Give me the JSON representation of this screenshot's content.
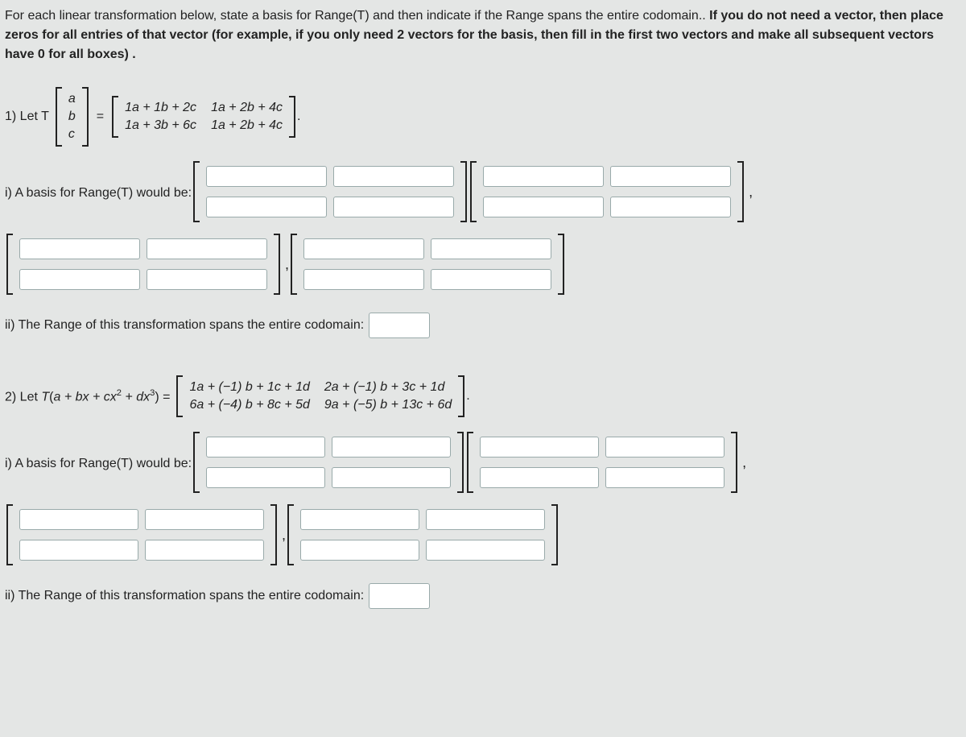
{
  "intro": {
    "line1_a": "For each linear transformation below, state a basis for Range(T) and then indicate if the Range spans the entire codomain.. ",
    "line1_b": "If you do not need a vector, then place zeros for all entries of that vector (for example, if you only need 2 vectors for the basis, then fill in the first two vectors and make all subsequent vectors have 0 for all boxes) ."
  },
  "p1": {
    "label": "1) Let T",
    "vec": [
      "a",
      "b",
      "c"
    ],
    "m": [
      [
        "1a + 1b + 2c",
        "1a + 2b + 4c"
      ],
      [
        "1a + 3b + 6c",
        "1a + 2b + 4c"
      ]
    ],
    "basis_label": "i) A basis for Range(T) would be:",
    "codomain_label": "ii) The Range of this transformation spans the entire codomain:"
  },
  "p2": {
    "label": "2) Let T(a + bx + cx² + dx³) =",
    "m": [
      [
        "1a + (−1) b + 1c + 1d",
        "2a + (−1) b + 3c + 1d"
      ],
      [
        "6a + (−4) b + 8c + 5d",
        "9a + (−5) b + 13c + 6d"
      ]
    ],
    "basis_label": "i) A basis for Range(T) would be:",
    "codomain_label": "ii) The Range of this transformation spans the entire codomain:"
  },
  "sym": {
    "eq": "=",
    "dot": ".",
    "comma": ","
  }
}
